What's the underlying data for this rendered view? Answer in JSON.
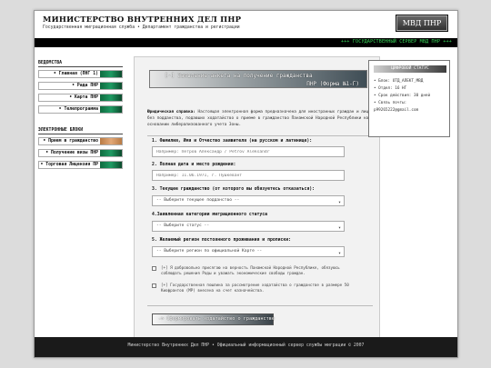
{
  "header": {
    "title": "МИНИСТЕРСТВО ВНУТРЕННИХ ДЕЛ ПНР",
    "subtitle": "Государственная миграционная служба • Департамент гражданства и регистрации",
    "logo": "МВД ПНР"
  },
  "banner": "+++ ГОСУДАРСТВЕННЫЙ СЕРВЕР МВД ПНР +++",
  "sidebar": {
    "sections": [
      {
        "title": "ВЕДОМСТВА",
        "items": [
          {
            "label": "• Главная (ПНГ 1)",
            "style": "green"
          },
          {
            "label": "• Рада ПНР",
            "style": "green"
          },
          {
            "label": "• Карта ПНР",
            "style": "green"
          },
          {
            "label": "• Телепрограмма",
            "style": "green"
          }
        ]
      },
      {
        "title": "ЭЛЕКТРОННЫЕ БЛОКИ",
        "items": [
          {
            "label": "• Прием в гражданство",
            "style": "orange"
          },
          {
            "label": "• Получение визы ПНР",
            "style": "green"
          },
          {
            "label": "• Торговая Лицензия ПР",
            "style": "green"
          }
        ]
      }
    ]
  },
  "form": {
    "title_line1": "[-] Заявление-анкета на получение гражданства",
    "title_line2": "ПНР (Форма №1-Г)",
    "intro_bold": "Юридическая справка:",
    "intro_text": "Настоящая электронная форма предназначена для иностранных граждан и лиц без подданства, подавших ходатайство о приеме в гражданство Панамской Народной Республики на основании либерализованного учета Зоны.",
    "q1": "1. Фамилия, Имя и Отчество заявителя (на русском и латинице):",
    "q1_placeholder": "Например: Петров Александр / Petrov Aleksandr",
    "q2": "2. Полная дата и место рождения:",
    "q2_placeholder": "Например: 11.06.1971, г. Пушкевант",
    "q3": "3. Текущее гражданство (от которого вы обязуетесь отказаться):",
    "q3_value": "-- Выберите текущее подданство --",
    "q4": "4.Заявленная категории миграционного статуса",
    "q4_value": "-- Выберите статус --",
    "q5": "5. Желаемый регион постоянного проживания и прописки:",
    "q5_value": "-- Выберите регион по официальной Карте --",
    "check1": "[+] Я добровольно присягаю на верность Панамской Народной Республике, обязуюсь соблюдать решения Рады и уважать экономические свободы граждан.",
    "check2": "[+] Государственная пошлина за рассмотрение ходатайства о гражданстве в размере 50 Киофрантов (МР) внесена на счет казначейства.",
    "submit": "-> Сформировать ходатайство о гражданстве"
  },
  "status_box": {
    "title": "ЦИФРОВОЙ СТАТУС",
    "rows": [
      "• Блок: ОТД_АЛЕКТ_МВД",
      "• Отдел: 16 НГ",
      "• Срок действия: 30 дней",
      "• Связь почты:",
      "p99265222@gmail.com"
    ]
  },
  "footer": "Министерство Внутренних Дел ПНР • Официальный информационный сервер службы миграции © 2007"
}
